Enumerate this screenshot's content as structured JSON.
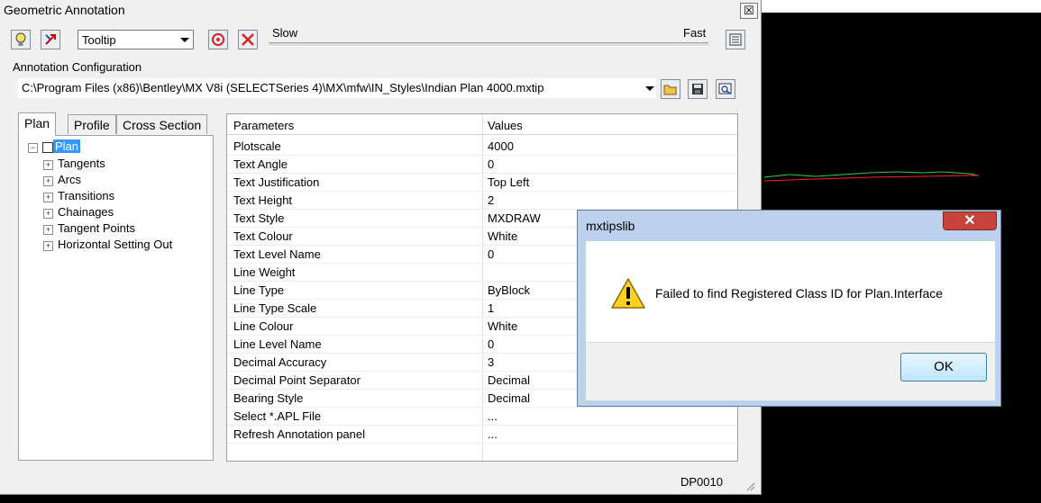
{
  "window": {
    "title": "Geometric Annotation",
    "close_glyph": "☒",
    "tooltip_combo_value": "Tooltip",
    "speed_slow": "Slow",
    "speed_fast": "Fast",
    "config_label": "Annotation Configuration",
    "config_path": "C:\\Program Files (x86)\\Bentley\\MX V8i (SELECTSeries 4)\\MX\\mfw\\IN_Styles\\Indian Plan 4000.mxtip",
    "tabs": [
      "Plan",
      "Profile",
      "Cross Section"
    ],
    "tree": {
      "root": "Plan",
      "children": [
        "Tangents",
        "Arcs",
        "Transitions",
        "Chainages",
        "Tangent Points",
        "Horizontal Setting Out"
      ]
    },
    "grid": {
      "headers": [
        "Parameters",
        "Values"
      ],
      "rows": [
        {
          "param": "Plotscale",
          "value": "4000"
        },
        {
          "param": "Text Angle",
          "value": "0"
        },
        {
          "param": "Text Justification",
          "value": "Top Left"
        },
        {
          "param": "Text Height",
          "value": "2"
        },
        {
          "param": "Text Style",
          "value": "MXDRAW"
        },
        {
          "param": "Text Colour",
          "value": "White"
        },
        {
          "param": "Text Level Name",
          "value": "0"
        },
        {
          "param": "Line Weight",
          "value": ""
        },
        {
          "param": "Line Type",
          "value": "ByBlock"
        },
        {
          "param": "Line Type Scale",
          "value": "1"
        },
        {
          "param": "Line Colour",
          "value": "White"
        },
        {
          "param": "Line Level Name",
          "value": "0"
        },
        {
          "param": "Decimal Accuracy",
          "value": "3"
        },
        {
          "param": "Decimal Point Separator",
          "value": "Decimal"
        },
        {
          "param": "Bearing Style",
          "value": "Decimal"
        },
        {
          "param": "Select *.APL File",
          "value": "..."
        },
        {
          "param": "Refresh Annotation panel",
          "value": "..."
        }
      ]
    },
    "status_code": "DP0010"
  },
  "dialog": {
    "title": "mxtipslib",
    "close_glyph": "✕",
    "message": "Failed to find Registered Class ID for Plan.Interface",
    "ok_label": "OK"
  },
  "colors": {
    "selection": "#3399ff",
    "dialog_frame": "#bcd1ec",
    "close_red": "#c7443a",
    "cad_green": "#2ecc40",
    "cad_red": "#ff2020"
  },
  "icons": [
    "lightbulb-icon",
    "pick-icon",
    "target-icon",
    "delete-icon",
    "list-icon",
    "open-folder-icon",
    "save-icon",
    "preview-icon",
    "warning-icon"
  ]
}
